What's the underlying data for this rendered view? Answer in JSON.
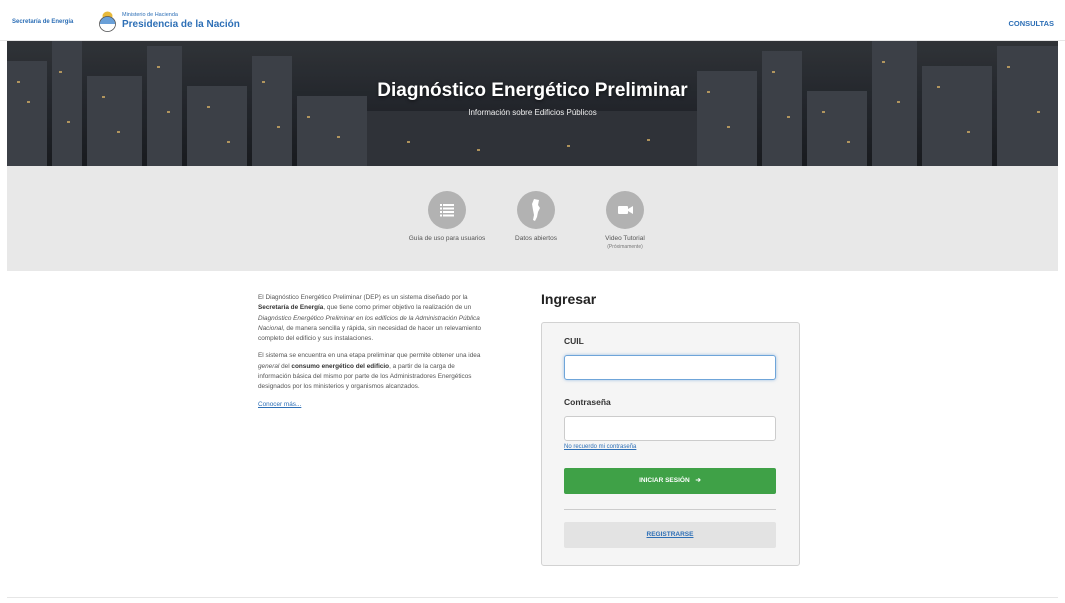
{
  "header": {
    "secretaria": "Secretaría de Energía",
    "ministerio": "Ministerio de Hacienda",
    "presidencia": "Presidencia de la Nación",
    "consultas": "CONSULTAS"
  },
  "hero": {
    "title": "Diagnóstico Energético Preliminar",
    "subtitle": "Información sobre Edificios Públicos"
  },
  "quick_links": [
    {
      "label": "Guía de uso para usuarios",
      "note": "",
      "icon": "list-icon"
    },
    {
      "label": "Datos abiertos",
      "note": "",
      "icon": "argentina-map-icon"
    },
    {
      "label": "Video Tutorial",
      "note": "(Próximamente)",
      "icon": "video-camera-icon"
    }
  ],
  "intro": {
    "p1_a": "El Diagnóstico Energético Preliminar (DEP) es un sistema diseñado por la ",
    "p1_b": "Secretaría de Energía",
    "p1_c": ", que tiene como primer objetivo la realización de un ",
    "p1_d": "Diagnóstico Energético Preliminar en los edificios de la Administración Pública Nacional",
    "p1_e": ", de manera sencilla y rápida, sin necesidad de hacer un relevamiento completo del edificio y sus instalaciones.",
    "p2_a": "El sistema se encuentra en una etapa preliminar que permite obtener una idea ",
    "p2_b": "general",
    "p2_c": " del ",
    "p2_d": "consumo energético del edificio",
    "p2_e": ", a partir de la carga de información básica del mismo por parte de los Administradores Energéticos designados por los ministerios y organismos alcanzados.",
    "more": "Conocer más..."
  },
  "login": {
    "title": "Ingresar",
    "cuil_label": "CUIL",
    "cuil_value": "",
    "password_label": "Contraseña",
    "password_value": "",
    "forgot": "No recuerdo mi contraseña",
    "submit": "INICIAR SESIÓN",
    "register": "REGISTRARSE"
  },
  "colors": {
    "brand_blue": "#2d6fb6",
    "submit_green": "#3fa147"
  }
}
